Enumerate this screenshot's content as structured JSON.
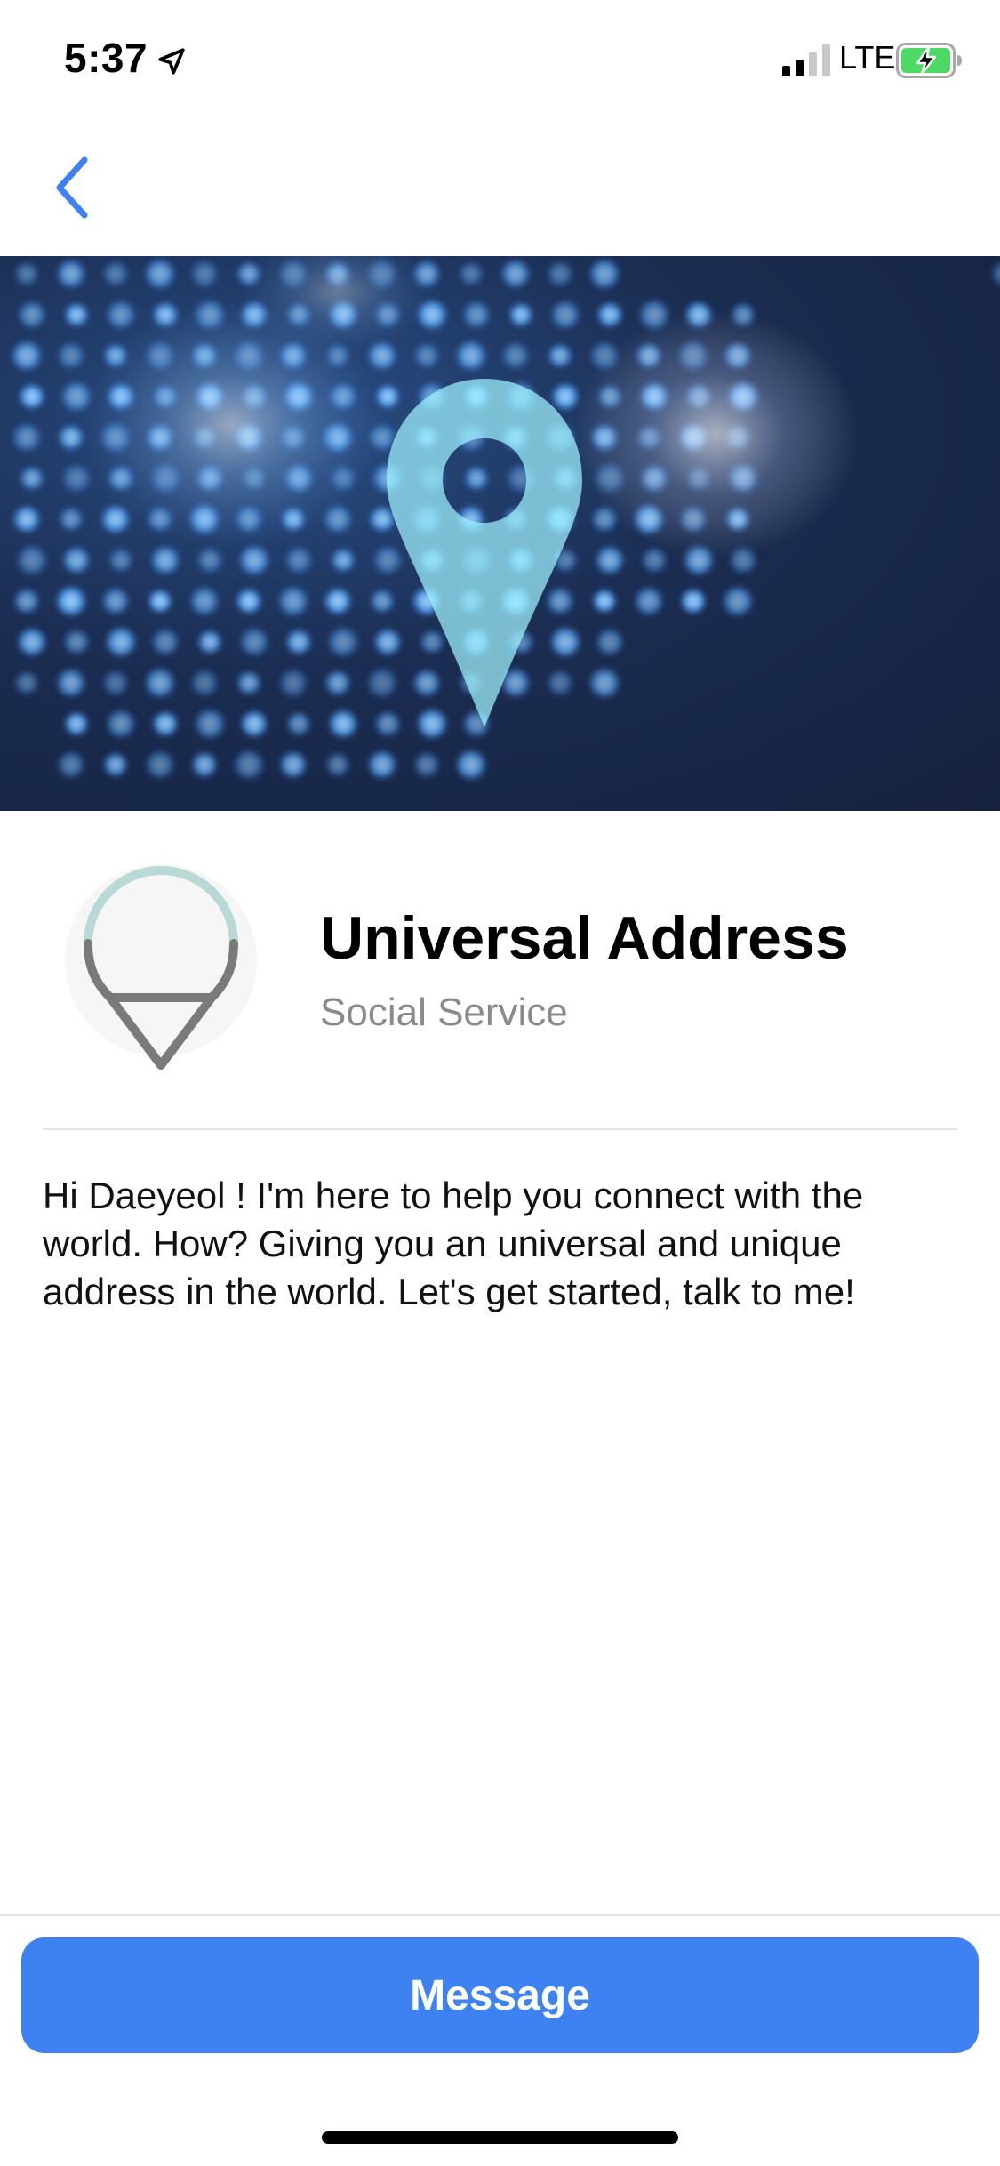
{
  "status_bar": {
    "time": "5:37",
    "network": "LTE",
    "icons": [
      "location-arrow-icon",
      "signal-bars-icon",
      "battery-charging-icon"
    ]
  },
  "nav": {
    "back_icon": "chevron-left-icon"
  },
  "profile": {
    "name": "Universal Address",
    "category": "Social Service",
    "logo_icon": "map-pin-logo-icon"
  },
  "description": "Hi Daeyeol ! I'm here to help you connect with the world. How? Giving you an universal and unique address in the world. Let's get started, talk to me!",
  "actions": {
    "message_label": "Message"
  },
  "colors": {
    "accent": "#3d82f0",
    "battery_charge": "#4cd964",
    "logo_top": "#b8d9d6",
    "logo_bottom": "#7a7a7a"
  }
}
